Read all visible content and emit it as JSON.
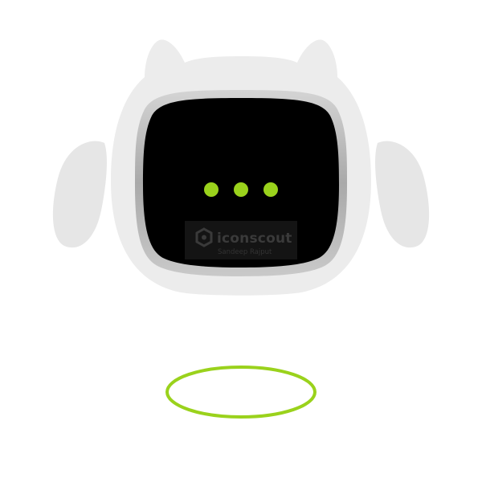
{
  "watermark": {
    "brand": "iconscout",
    "author": "Sandeep Rajput"
  },
  "indicator": {
    "state": "typing",
    "dot_count": 3
  },
  "colors": {
    "background": "#ffffff",
    "robot_body": "#ececec",
    "robot_arms": "#e6e6e6",
    "screen": "#000000",
    "screen_bezel": "#b9b9b9",
    "accent_green": "#9ad21c",
    "halo_ring": "#9ad21c"
  },
  "icons": {
    "watermark_logo": "iconscout-logo-icon",
    "typing_indicator": "typing-dots-icon"
  }
}
